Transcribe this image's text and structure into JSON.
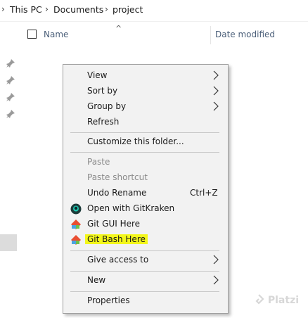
{
  "breadcrumb": [
    "This PC",
    "Documents",
    "project"
  ],
  "header": {
    "name_label": "Name",
    "date_label": "Date modified"
  },
  "menu": {
    "view": "View",
    "sort_by": "Sort by",
    "group_by": "Group by",
    "refresh": "Refresh",
    "customize": "Customize this folder...",
    "paste": "Paste",
    "paste_shortcut": "Paste shortcut",
    "undo_rename": "Undo Rename",
    "undo_shortcut": "Ctrl+Z",
    "gitkraken": "Open with GitKraken",
    "git_gui": "Git GUI Here",
    "git_bash": "Git Bash Here",
    "give_access": "Give access to",
    "new": "New",
    "properties": "Properties"
  },
  "highlight_color": "#f3f71a",
  "watermark": "Platzi"
}
